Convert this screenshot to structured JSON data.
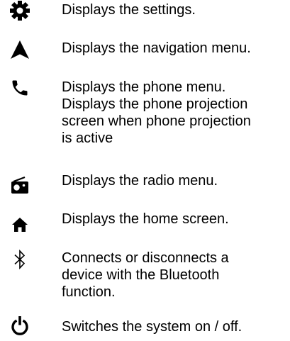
{
  "items": [
    {
      "icon": "gear-icon",
      "text": "Displays the settings."
    },
    {
      "icon": "navigation-arrow-icon",
      "text": "Displays the navigation menu."
    },
    {
      "icon": "phone-icon",
      "text": "Displays the phone menu.\nDisplays the phone projection\nscreen when phone projection\nis active"
    },
    {
      "icon": "radio-icon",
      "text": "Displays the radio menu."
    },
    {
      "icon": "home-icon",
      "text": "Displays the home screen."
    },
    {
      "icon": "bluetooth-icon",
      "text": "Connects or disconnects a\ndevice with the Bluetooth\nfunction."
    },
    {
      "icon": "power-icon",
      "text": "Switches the system on / off."
    }
  ]
}
